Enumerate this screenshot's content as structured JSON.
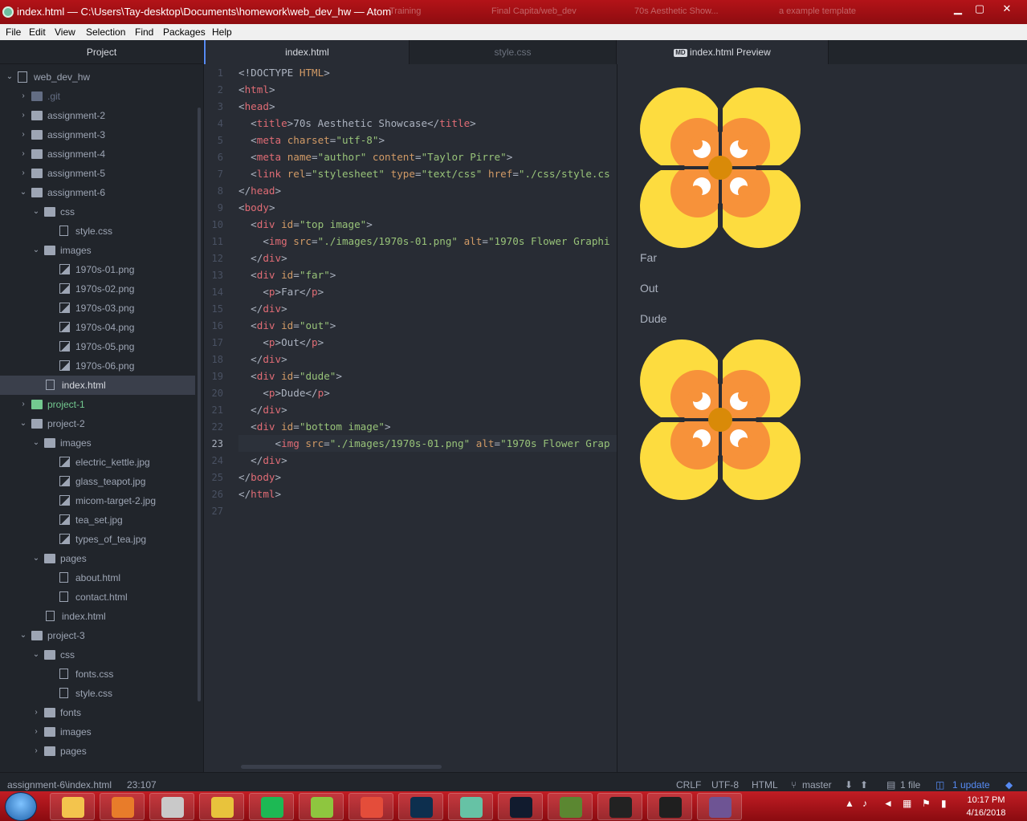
{
  "window": {
    "title": "index.html — C:\\Users\\Tay-desktop\\Documents\\homework\\web_dev_hw — Atom",
    "ghost_tabs": [
      "Training",
      "Final Capita/web_dev",
      "70s Aesthetic Show...",
      "a example template"
    ],
    "minimize": "▁",
    "maximize": "▢",
    "close": "✕"
  },
  "menu": [
    "File",
    "Edit",
    "View",
    "Selection",
    "Find",
    "Packages",
    "Help"
  ],
  "tree": {
    "header": "Project",
    "rows": [
      {
        "label": "web_dev_hw",
        "depth": 0,
        "type": "repo",
        "open": true
      },
      {
        "label": ".git",
        "depth": 1,
        "type": "folder",
        "open": false,
        "ignored": true
      },
      {
        "label": "assignment-2",
        "depth": 1,
        "type": "folder",
        "open": false
      },
      {
        "label": "assignment-3",
        "depth": 1,
        "type": "folder",
        "open": false
      },
      {
        "label": "assignment-4",
        "depth": 1,
        "type": "folder",
        "open": false
      },
      {
        "label": "assignment-5",
        "depth": 1,
        "type": "folder",
        "open": false
      },
      {
        "label": "assignment-6",
        "depth": 1,
        "type": "folder",
        "open": true
      },
      {
        "label": "css",
        "depth": 2,
        "type": "folder",
        "open": true
      },
      {
        "label": "style.css",
        "depth": 3,
        "type": "file"
      },
      {
        "label": "images",
        "depth": 2,
        "type": "folder",
        "open": true
      },
      {
        "label": "1970s-01.png",
        "depth": 3,
        "type": "image"
      },
      {
        "label": "1970s-02.png",
        "depth": 3,
        "type": "image"
      },
      {
        "label": "1970s-03.png",
        "depth": 3,
        "type": "image"
      },
      {
        "label": "1970s-04.png",
        "depth": 3,
        "type": "image"
      },
      {
        "label": "1970s-05.png",
        "depth": 3,
        "type": "image"
      },
      {
        "label": "1970s-06.png",
        "depth": 3,
        "type": "image"
      },
      {
        "label": "index.html",
        "depth": 2,
        "type": "file",
        "selected": true
      },
      {
        "label": "project-1",
        "depth": 1,
        "type": "folder",
        "open": false,
        "git": true
      },
      {
        "label": "project-2",
        "depth": 1,
        "type": "folder",
        "open": true
      },
      {
        "label": "images",
        "depth": 2,
        "type": "folder",
        "open": true
      },
      {
        "label": "electric_kettle.jpg",
        "depth": 3,
        "type": "image"
      },
      {
        "label": "glass_teapot.jpg",
        "depth": 3,
        "type": "image"
      },
      {
        "label": "micom-target-2.jpg",
        "depth": 3,
        "type": "image"
      },
      {
        "label": "tea_set.jpg",
        "depth": 3,
        "type": "image"
      },
      {
        "label": "types_of_tea.jpg",
        "depth": 3,
        "type": "image"
      },
      {
        "label": "pages",
        "depth": 2,
        "type": "folder",
        "open": true
      },
      {
        "label": "about.html",
        "depth": 3,
        "type": "file"
      },
      {
        "label": "contact.html",
        "depth": 3,
        "type": "file"
      },
      {
        "label": "index.html",
        "depth": 2,
        "type": "file"
      },
      {
        "label": "project-3",
        "depth": 1,
        "type": "folder",
        "open": true
      },
      {
        "label": "css",
        "depth": 2,
        "type": "folder",
        "open": true
      },
      {
        "label": "fonts.css",
        "depth": 3,
        "type": "file"
      },
      {
        "label": "style.css",
        "depth": 3,
        "type": "file"
      },
      {
        "label": "fonts",
        "depth": 2,
        "type": "folder",
        "open": false
      },
      {
        "label": "images",
        "depth": 2,
        "type": "folder",
        "open": false
      },
      {
        "label": "pages",
        "depth": 2,
        "type": "folder",
        "open": false
      }
    ]
  },
  "tabs": {
    "editor_active": "index.html",
    "editor_other": "style.css",
    "preview": "index.html Preview",
    "preview_badge": "MD"
  },
  "code": {
    "current_line": 23,
    "lines": [
      "<!DOCTYPE HTML>",
      "<html>",
      "<head>",
      "  <title>70s Aesthetic Showcase</title>",
      "  <meta charset=\"utf-8\">",
      "  <meta name=\"author\" content=\"Taylor Pirre\">",
      "  <link rel=\"stylesheet\" type=\"text/css\" href=\"./css/style.cs",
      "</head>",
      "<body>",
      "  <div id=\"top image\">",
      "    <img src=\"./images/1970s-01.png\" alt=\"1970s Flower Graphi",
      "  </div>",
      "  <div id=\"far\">",
      "    <p>Far</p>",
      "  </div>",
      "  <div id=\"out\">",
      "    <p>Out</p>",
      "  </div>",
      "  <div id=\"dude\">",
      "    <p>Dude</p>",
      "  </div>",
      "  <div id=\"bottom image\">",
      "      <img src=\"./images/1970s-01.png\" alt=\"1970s Flower Grap",
      "  </div>",
      "</body>",
      "</html>",
      ""
    ]
  },
  "preview": {
    "texts": [
      "Far",
      "Out",
      "Dude"
    ]
  },
  "status": {
    "path": "assignment-6\\index.html",
    "cursor": "23:107",
    "line_ending": "CRLF",
    "encoding": "UTF-8",
    "grammar": "HTML",
    "branch": "master",
    "files": "1 file",
    "updates": "1 update"
  },
  "taskbar": {
    "time": "10:17 PM",
    "date": "4/16/2018",
    "apps": [
      "file-explorer",
      "media-player",
      "snipping-tool",
      "sonic",
      "spotify",
      "camera-app",
      "chrome",
      "photoshop",
      "atom",
      "battle-net",
      "minecraft",
      "unity",
      "muse",
      "github-desktop"
    ]
  },
  "colors": {
    "flower_outer": "#fddc3f",
    "flower_inner": "#f7923a",
    "flower_center": "#d98a08",
    "flower_dot": "#ffffff",
    "accent": "#568af2"
  }
}
